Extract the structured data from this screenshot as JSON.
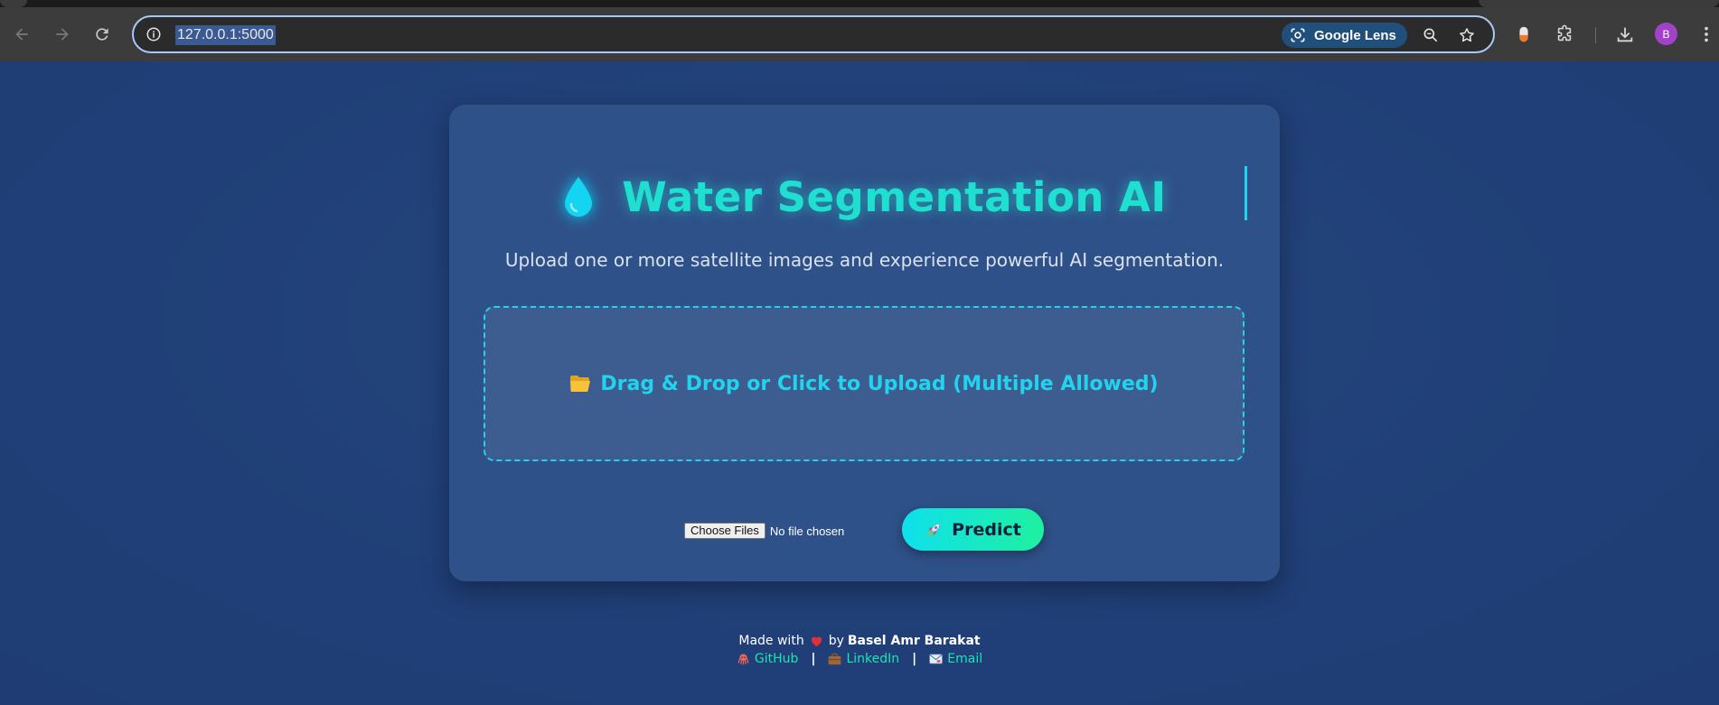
{
  "browser": {
    "url": "127.0.0.1:5000",
    "lens_label": "Google Lens",
    "avatar_letter": "B",
    "icons": [
      "back-icon",
      "forward-icon",
      "reload-icon",
      "site-info-icon",
      "google-lens-icon",
      "zoom-icon",
      "bookmark-star-icon",
      "extension-pill-icon",
      "extensions-puzzle-icon",
      "download-icon",
      "more-menu-icon"
    ]
  },
  "app": {
    "title": "Water Segmentation AI",
    "subtitle": "Upload one or more satellite images and experience powerful AI segmentation.",
    "dropzone_label": "Drag & Drop or Click to Upload (Multiple Allowed)",
    "choose_files_label": "Choose Files",
    "no_file_label": "No file chosen",
    "predict_label": "Predict",
    "colors": {
      "title": "#1fe0d0",
      "accent": "#22d3ee",
      "card": "#2f5189",
      "background": "#203f78",
      "link": "#1de3b0"
    }
  },
  "footer": {
    "made_with": "Made with",
    "by": "by",
    "author": "Basel Amr Barakat",
    "separator": "|",
    "links": {
      "github": "GitHub",
      "linkedin": "LinkedIn",
      "email": "Email"
    }
  }
}
